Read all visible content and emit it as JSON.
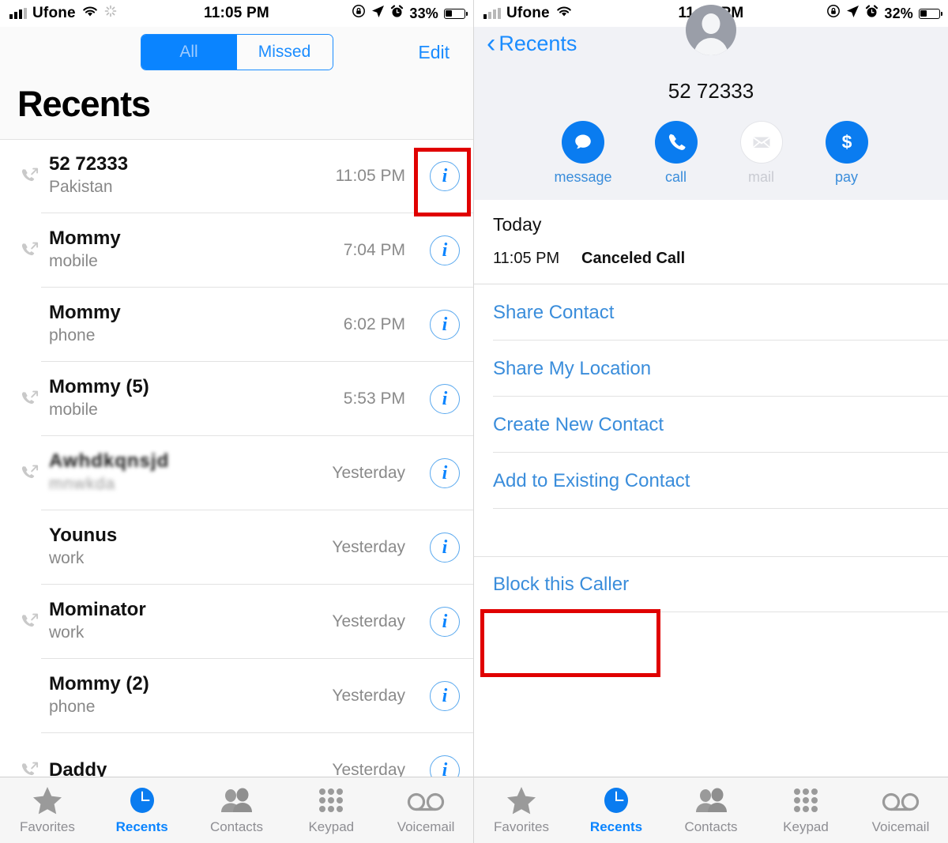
{
  "left": {
    "status_bar": {
      "carrier": "Ufone",
      "time": "11:05 PM",
      "battery_percent": "33%",
      "icons": [
        "signal-bars-icon",
        "wifi-icon",
        "sync-spinner-icon",
        "rotation-lock-icon",
        "location-arrow-icon",
        "alarm-clock-icon",
        "battery-icon"
      ]
    },
    "segmented": {
      "all": "All",
      "missed": "Missed",
      "selected": "All"
    },
    "edit_label": "Edit",
    "page_title": "Recents",
    "calls": [
      {
        "name": "52 72333",
        "sub": "Pakistan",
        "time": "11:05 PM",
        "direction": "outgoing",
        "redacted": false
      },
      {
        "name": "Mommy",
        "sub": "mobile",
        "time": "7:04 PM",
        "direction": "outgoing",
        "redacted": false
      },
      {
        "name": "Mommy",
        "sub": "phone",
        "time": "6:02 PM",
        "direction": "none",
        "redacted": false
      },
      {
        "name": "Mommy (5)",
        "sub": "mobile",
        "time": "5:53 PM",
        "direction": "outgoing",
        "redacted": false
      },
      {
        "name": "Awhdkqnsjd",
        "sub": "mnwkda",
        "time": "Yesterday",
        "direction": "outgoing",
        "redacted": true
      },
      {
        "name": "Younus",
        "sub": "work",
        "time": "Yesterday",
        "direction": "none",
        "redacted": false
      },
      {
        "name": "Mominator",
        "sub": "work",
        "time": "Yesterday",
        "direction": "outgoing",
        "redacted": false
      },
      {
        "name": "Mommy (2)",
        "sub": "phone",
        "time": "Yesterday",
        "direction": "none",
        "redacted": false
      },
      {
        "name": "Daddy",
        "sub": "",
        "time": "Yesterday",
        "direction": "outgoing",
        "redacted": false
      }
    ],
    "highlight": {
      "target": "info-button-row-1",
      "color": "#e00000"
    }
  },
  "right": {
    "status_bar": {
      "carrier": "Ufone",
      "time": "11:44 PM",
      "battery_percent": "32%",
      "icons": [
        "signal-bars-icon",
        "wifi-icon",
        "rotation-lock-icon",
        "location-arrow-icon",
        "alarm-clock-icon",
        "battery-icon"
      ]
    },
    "back_label": "Recents",
    "contact_number": "52 72333",
    "actions": [
      {
        "label": "message",
        "icon": "message-bubble-icon",
        "enabled": true
      },
      {
        "label": "call",
        "icon": "phone-handset-icon",
        "enabled": true
      },
      {
        "label": "mail",
        "icon": "envelope-icon",
        "enabled": false
      },
      {
        "label": "pay",
        "icon": "dollar-sign-icon",
        "enabled": true
      }
    ],
    "history": {
      "day": "Today",
      "time": "11:05 PM",
      "type": "Canceled Call"
    },
    "options": [
      {
        "label": "Share Contact",
        "spaced": false
      },
      {
        "label": "Share My Location",
        "spaced": false
      },
      {
        "label": "Create New Contact",
        "spaced": false
      },
      {
        "label": "Add to Existing Contact",
        "spaced": false
      },
      {
        "label": "Block this Caller",
        "spaced": true
      }
    ],
    "highlight": {
      "target": "block-this-caller-option",
      "color": "#e00000"
    }
  },
  "tabbar": {
    "items": [
      {
        "label": "Favorites",
        "icon": "star-icon",
        "active": false
      },
      {
        "label": "Recents",
        "icon": "clock-icon",
        "active": true
      },
      {
        "label": "Contacts",
        "icon": "people-icon",
        "active": false
      },
      {
        "label": "Keypad",
        "icon": "keypad-icon",
        "active": false
      },
      {
        "label": "Voicemail",
        "icon": "voicemail-icon",
        "active": false
      }
    ]
  },
  "colors": {
    "accent": "#0a84ff",
    "link": "#3a8ddb",
    "highlight": "#e00000",
    "muted": "#8e8e93"
  }
}
